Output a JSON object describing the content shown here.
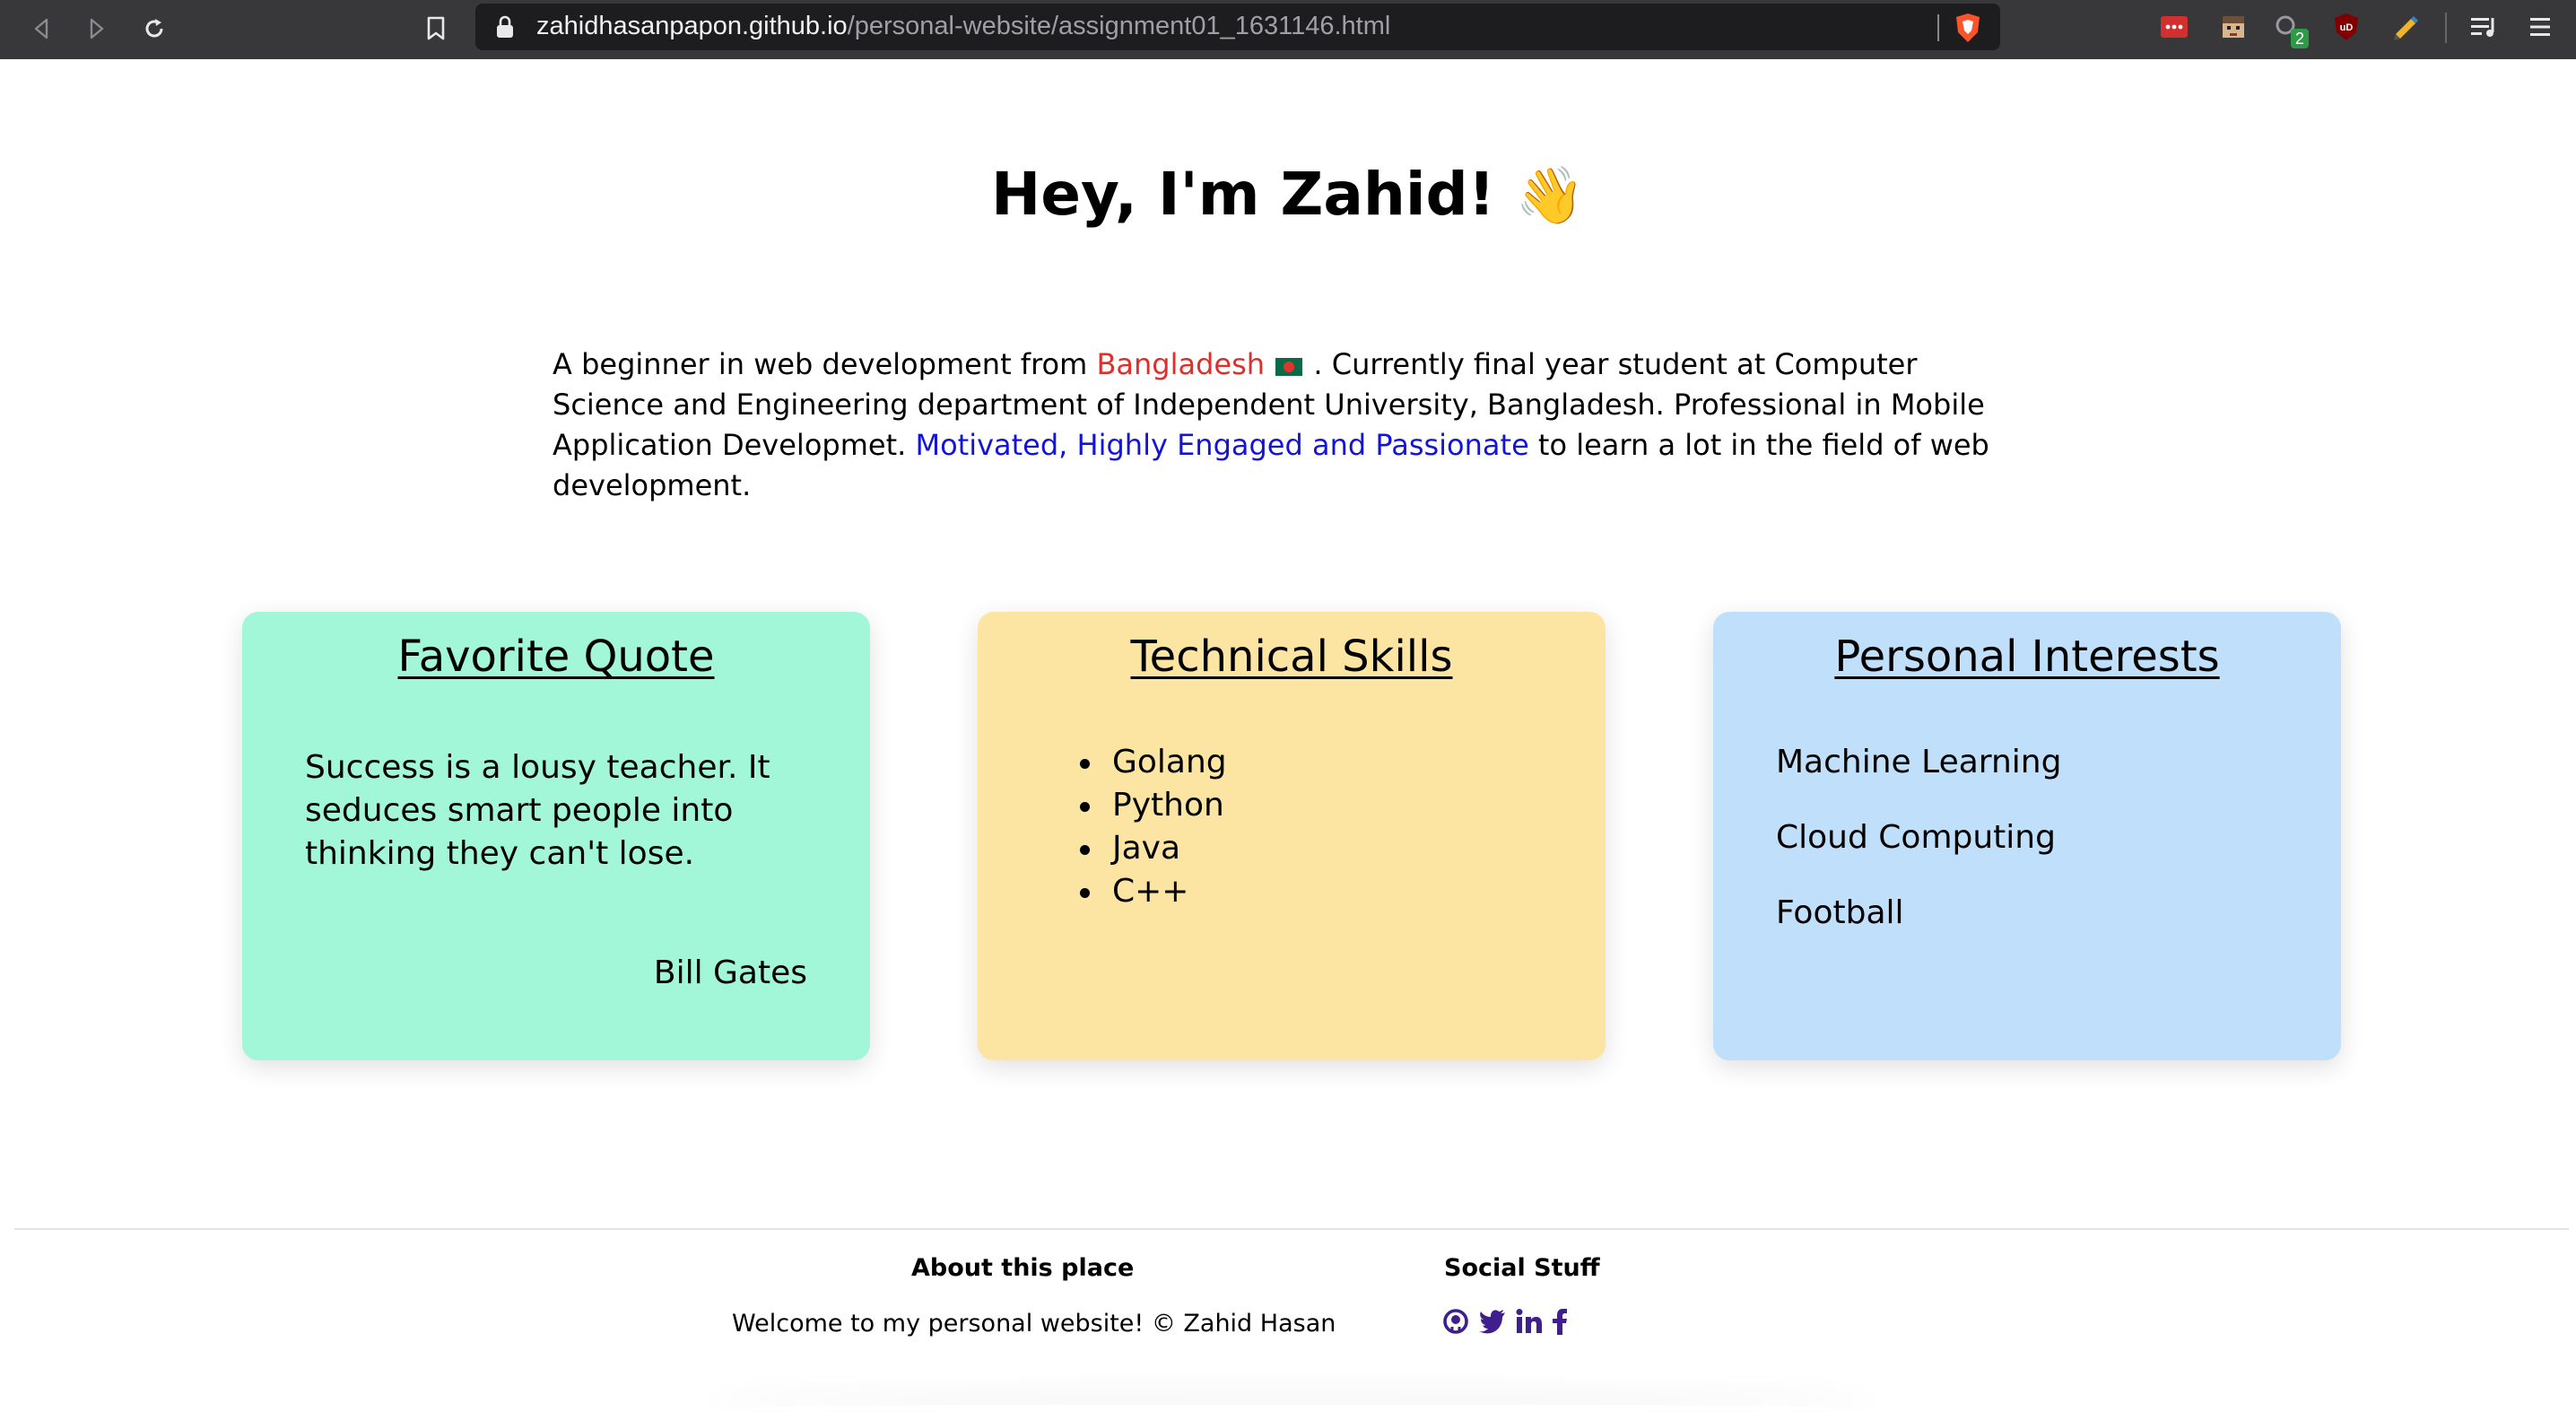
{
  "browser": {
    "url_host": "zahidhasanpapon.github.io",
    "url_path": "/personal-website/assignment01_1631146.html",
    "extension_badge": "2"
  },
  "hero": {
    "title": "Hey, I'm Zahid!",
    "emoji": "👋"
  },
  "intro": {
    "part1": "A beginner in web development from ",
    "country": "Bangladesh",
    "part2": " . Currently final year student at Computer Science and Engineering department of Independent University, Bangladesh. Professional in Mobile Application Developmet. ",
    "highlight": "Motivated, Highly Engaged and Passionate",
    "part3": " to learn a lot in the field of web development."
  },
  "cards": {
    "quote": {
      "title": "Favorite Quote",
      "text": "Success is a lousy teacher. It seduces smart people into thinking they can't lose.",
      "author": "Bill Gates",
      "bg": "#a1f7d8"
    },
    "skills": {
      "title": "Technical Skills",
      "items": [
        "Golang",
        "Python",
        "Java",
        "C++"
      ],
      "bg": "#fce4a2"
    },
    "interests": {
      "title": "Personal Interests",
      "items": [
        "Machine Learning",
        "Cloud Computing",
        "Football"
      ],
      "bg": "#bfdffb"
    }
  },
  "footer": {
    "about_title": "About this place",
    "about_text": "Welcome to my personal website! © Zahid Hasan",
    "social_title": "Social Stuff",
    "social_icons": [
      "github-icon",
      "twitter-icon",
      "linkedin-icon",
      "facebook-icon"
    ],
    "social_color": "#3e1f8c"
  },
  "colors": {
    "country": "#e02f2a",
    "highlight": "#1414d8"
  }
}
